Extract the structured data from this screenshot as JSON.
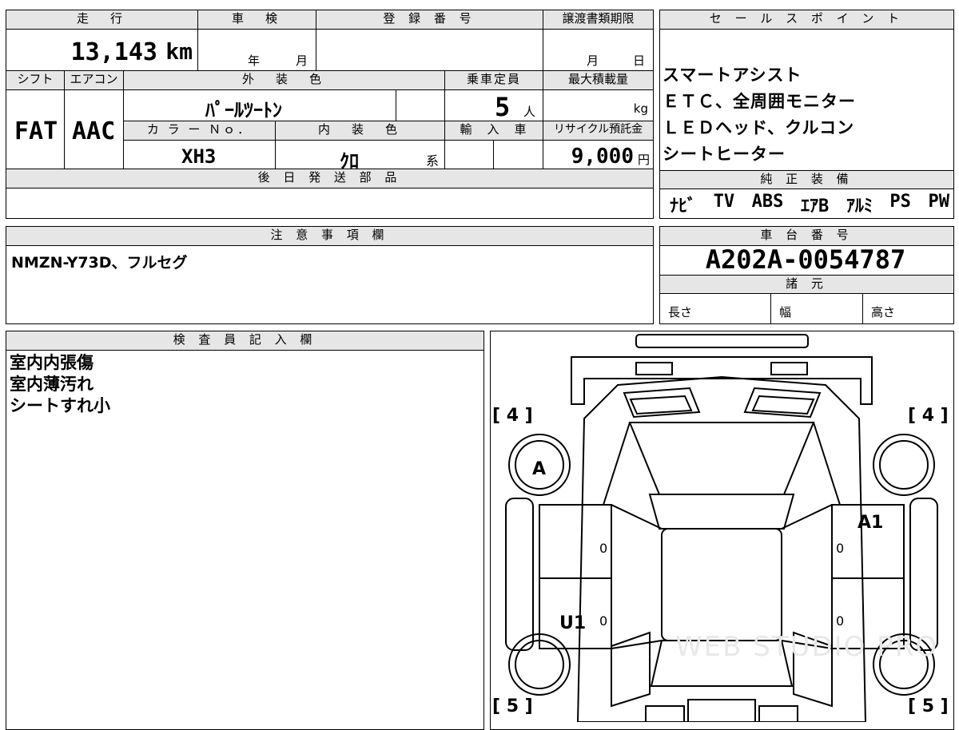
{
  "vehicle": {
    "headers": {
      "mileage": "走　行",
      "inspection": "車　検",
      "registration": "登 録 番 号",
      "transfer_deadline": "譲渡書類期限",
      "shift": "シフト",
      "aircon": "エアコン",
      "exterior_color": "外　装　色",
      "capacity": "乗車定員",
      "max_load": "最大積載量",
      "color_no": "カ ラ ー Ｎｏ．",
      "interior_color": "内　装　色",
      "import": "輸　入　車",
      "recycle_fee": "リサイクル預託金"
    },
    "mileage_value": "13,143",
    "mileage_unit": "km",
    "inspection_year": "年",
    "inspection_month": "月",
    "transfer_month": "月",
    "transfer_day": "日",
    "shift_value": "FAT",
    "aircon_value": "AAC",
    "exterior_color_value": "ﾊﾟｰﾙﾂｰﾄﾝ",
    "capacity_value": "5",
    "capacity_unit": "人",
    "max_load_unit": "kg",
    "color_no_value": "XH3",
    "interior_color_value": "ｸﾛ",
    "interior_color_suffix": "系",
    "recycle_fee_value": "9,000",
    "recycle_fee_unit": "円"
  },
  "later_parts": {
    "header": "後 日 発 送 部 品",
    "content": ""
  },
  "sales_points": {
    "header": "セ ー ル ス ポ イ ン ト",
    "lines": [
      "スマートアシスト",
      "ＥＴＣ、全周囲モニター",
      "ＬＥＤヘッド、クルコン",
      "シートヒーター"
    ]
  },
  "standard_equipment": {
    "header": "純 正 装 備",
    "items": [
      "ﾅﾋﾞ",
      "TV",
      "ABS",
      "ｴｱB",
      "ｱﾙﾐ",
      "PS",
      "PW"
    ]
  },
  "notes": {
    "header": "注 意 事 項 欄",
    "content": "NMZN-Y73D、フルセグ"
  },
  "chassis": {
    "header": "車 台 番 号",
    "number": "A202A-0054787",
    "spec_header": "諸 元",
    "length_label": "長さ",
    "width_label": "幅",
    "height_label": "高さ"
  },
  "inspector": {
    "header": "検 査 員 記 入 欄",
    "lines": [
      "室内内張傷",
      "室内薄汚れ",
      "シートすれ小"
    ]
  },
  "diagram": {
    "tread_front_left": "[ 4 ]",
    "tread_front_right": "[ 4 ]",
    "tread_rear_left": "[ 5 ]",
    "tread_rear_right": "[ 5 ]",
    "mark_a": "A",
    "mark_a1": "A1",
    "mark_u1": "U1",
    "door_zero": "0",
    "watermark": "WEB STUDIO PRO"
  }
}
